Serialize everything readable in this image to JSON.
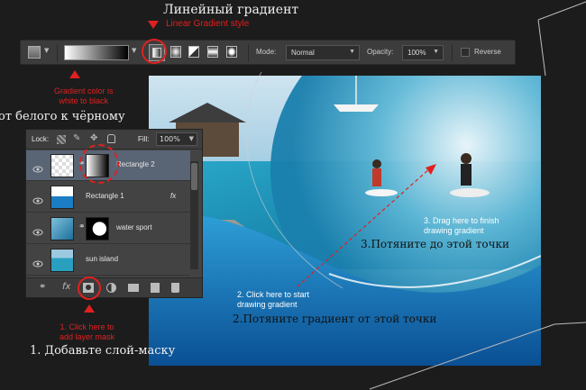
{
  "annotations": {
    "top_title_ru": "Линейный градиент",
    "top_title_en": "Linear Gradient style",
    "gradient_note": "Gradient color is\nwhite to black",
    "from_white_ru": "от белого к чёрному",
    "step1_en": "1. Click here to\nadd layer mask",
    "step1_ru": "1. Добавьте слой-маску",
    "step2_en": "2. Click here to start\ndrawing gradient",
    "step2_ru": "2.Потяните градиент от этой точки",
    "step3_en": "3. Drag here to finish\ndrawing gradient",
    "step3_ru": "3.Потяните до этой точки"
  },
  "options_bar": {
    "mode_label": "Mode:",
    "mode_value": "Normal",
    "opacity_label": "Opacity:",
    "opacity_value": "100%",
    "reverse_label": "Reverse",
    "styles": [
      "linear-gradient-icon",
      "radial-gradient-icon",
      "angle-gradient-icon",
      "reflected-gradient-icon",
      "diamond-gradient-icon"
    ]
  },
  "layers_panel": {
    "lock_label": "Lock:",
    "fill_label": "Fill:",
    "fill_value": "100%",
    "layers": [
      "Rectangle 2",
      "Rectangle 1",
      "water sport",
      "sun island"
    ],
    "fx_label": "fx"
  },
  "colors": {
    "accent_red": "#e02020",
    "panel_bg": "#434343",
    "selected_row": "#5a6a80"
  }
}
